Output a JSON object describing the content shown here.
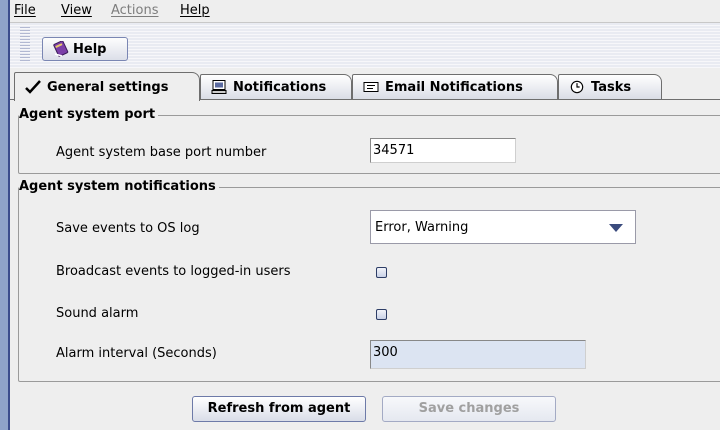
{
  "menu": [
    "File",
    "View",
    "Actions",
    "Help"
  ],
  "toolbar": {
    "help_label": "Help"
  },
  "tabs": [
    {
      "label": "General settings",
      "icon": "check-icon",
      "active": true
    },
    {
      "label": "Notifications",
      "icon": "computer-icon",
      "active": false
    },
    {
      "label": "Email Notifications",
      "icon": "email-icon",
      "active": false
    },
    {
      "label": "Tasks",
      "icon": "clock-icon",
      "active": false
    }
  ],
  "port_group": {
    "title": "Agent system port",
    "base_port_label": "Agent system base port number",
    "base_port_value": "34571"
  },
  "notifications_group": {
    "title": "Agent system notifications",
    "save_events_label": "Save events to OS log",
    "save_events_value": "Error, Warning",
    "broadcast_label": "Broadcast events to logged-in users",
    "broadcast_checked": false,
    "sound_alarm_label": "Sound alarm",
    "sound_alarm_checked": false,
    "alarm_interval_label": "Alarm interval (Seconds)",
    "alarm_interval_value": "300"
  },
  "buttons": {
    "refresh_label": "Refresh from agent",
    "save_label": "Save changes"
  },
  "colors": {
    "accent": "#3b4c8c",
    "background": "#eeeeee",
    "disabled_field": "#dce4f2"
  }
}
